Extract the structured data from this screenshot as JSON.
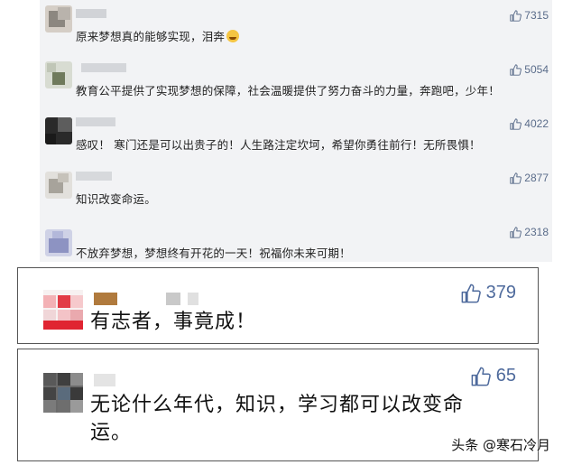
{
  "small_comments": [
    {
      "likes": "7315",
      "text": "原来梦想真的能够实现，泪奔"
    },
    {
      "likes": "5054",
      "text": "教育公平提供了实现梦想的保障，社会温暖提供了努力奋斗的力量，奔跑吧，少年！"
    },
    {
      "likes": "4022",
      "text": "感叹！ 寒门还是可以出贵子的！人生路注定坎坷，希望你勇往前行！无所畏惧！"
    },
    {
      "likes": "2877",
      "text": "知识改变命运。"
    },
    {
      "likes": "2318",
      "text": "不放弃梦想，梦想终有开花的一天！祝福你未来可期！"
    }
  ],
  "big_comments": [
    {
      "likes": "379",
      "text": "有志者，事竟成！"
    },
    {
      "likes": "65",
      "text_line1": "无论什么年代，知识，学习都可以改变命",
      "text_line2": "运。"
    }
  ],
  "watermark": "头条 @寒石冷月",
  "icons": {
    "like": "thumb-up-icon",
    "crying_emoji": "crying-emoji-icon"
  },
  "colors": {
    "panel_bg": "#f2f3f5",
    "likes_small": "#5a6c8a",
    "likes_big": "#4e6a9c"
  }
}
